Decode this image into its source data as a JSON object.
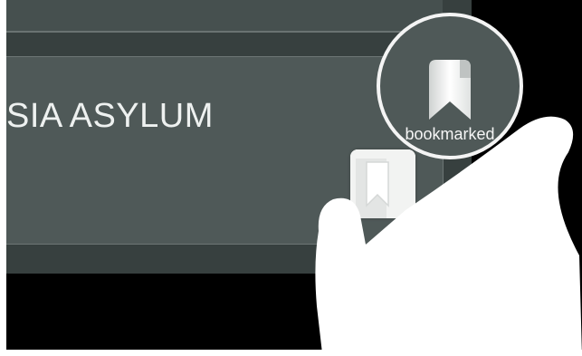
{
  "card": {
    "title": "SIA ASYLUM"
  },
  "zoom": {
    "label": "bookmarked"
  },
  "icons": {
    "bookmark": "bookmark-icon",
    "hand": "hand-gesture"
  },
  "colors": {
    "panel": "#37403f",
    "card": "#4f5958",
    "text": "#eef1f0",
    "highlight": "#f4f4f4"
  }
}
